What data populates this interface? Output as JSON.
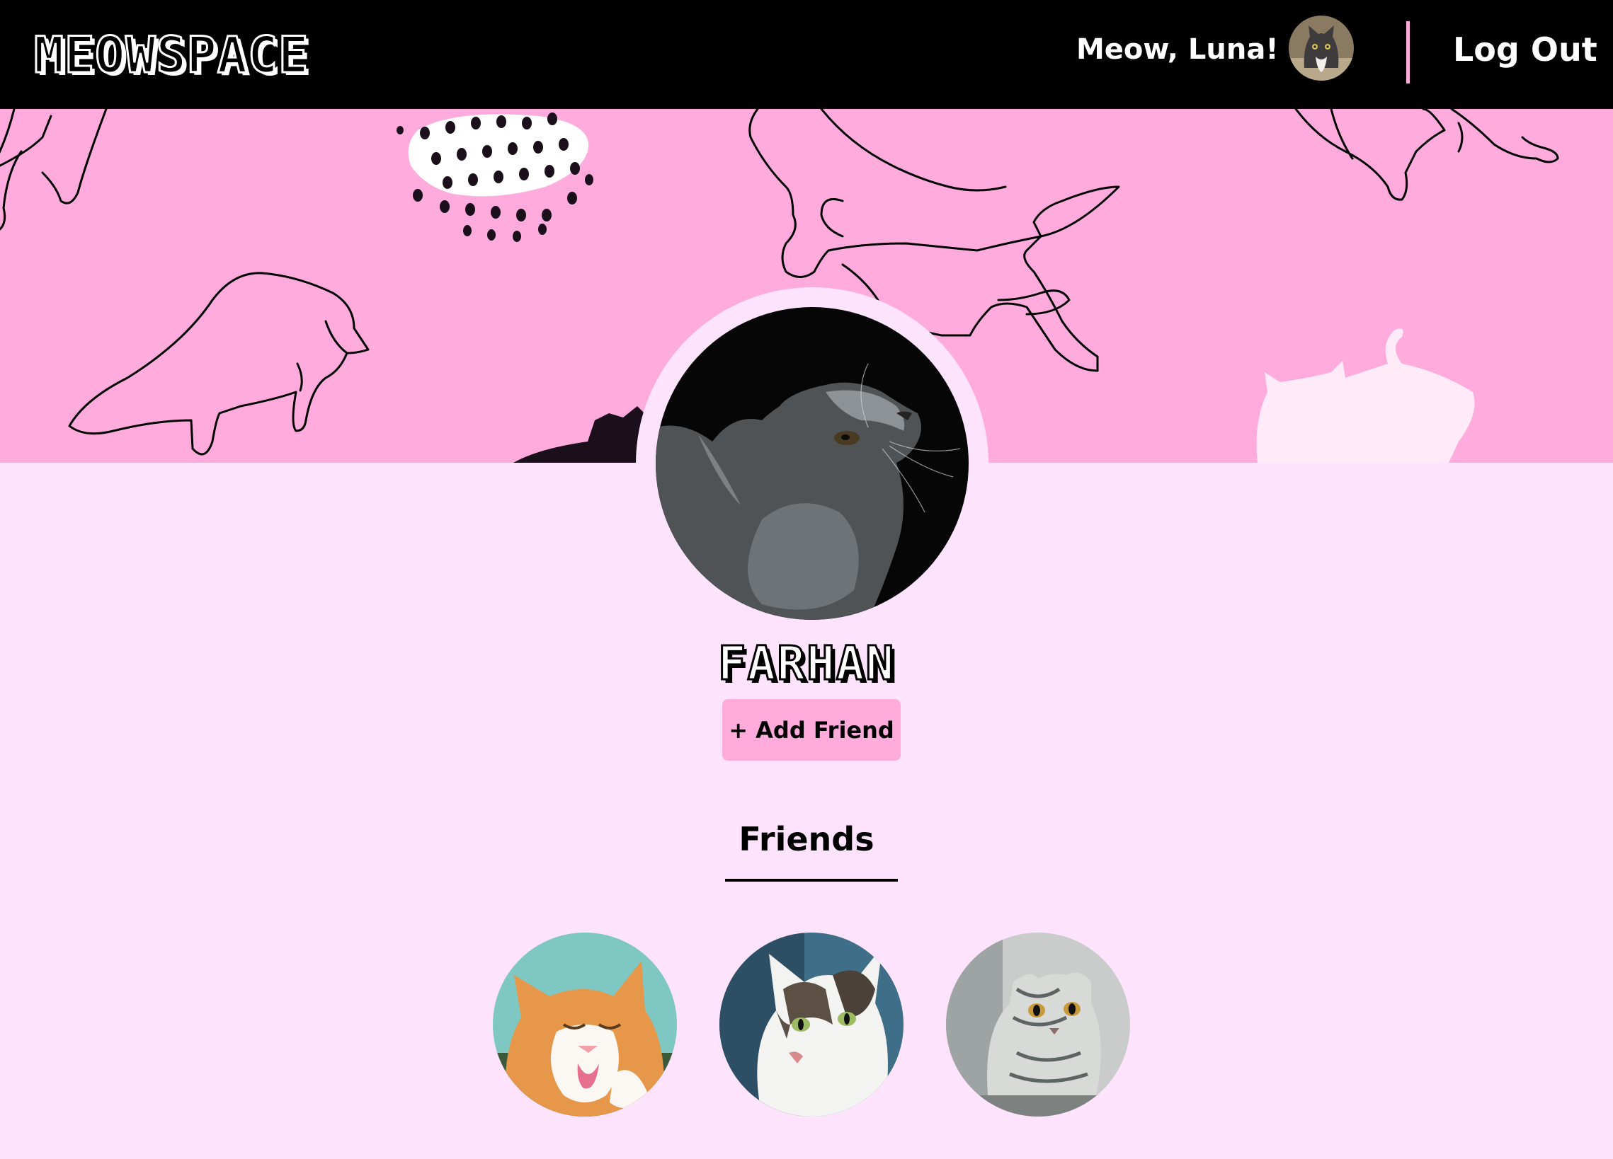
{
  "header": {
    "logo": "MEOWSPACE",
    "greeting": "Meow, Luna!",
    "logout_label": "Log Out",
    "avatar_icon": "gray-cat-avatar"
  },
  "banner": {
    "pattern_icon": "cat-line-drawings-pattern",
    "color": "#ffabdd"
  },
  "profile": {
    "name": "FARHAN",
    "photo_icon": "gray-fluffy-cat-photo",
    "add_friend_label": "+ Add Friend"
  },
  "friends": {
    "heading": "Friends",
    "items": [
      {
        "icon": "orange-white-cat-photo"
      },
      {
        "icon": "tabby-white-cat-photo"
      },
      {
        "icon": "silver-scottish-fold-cat-photo"
      }
    ]
  },
  "colors": {
    "topbar": "#000000",
    "page_background": "#fee3fc",
    "accent_pink": "#ffacdc"
  }
}
